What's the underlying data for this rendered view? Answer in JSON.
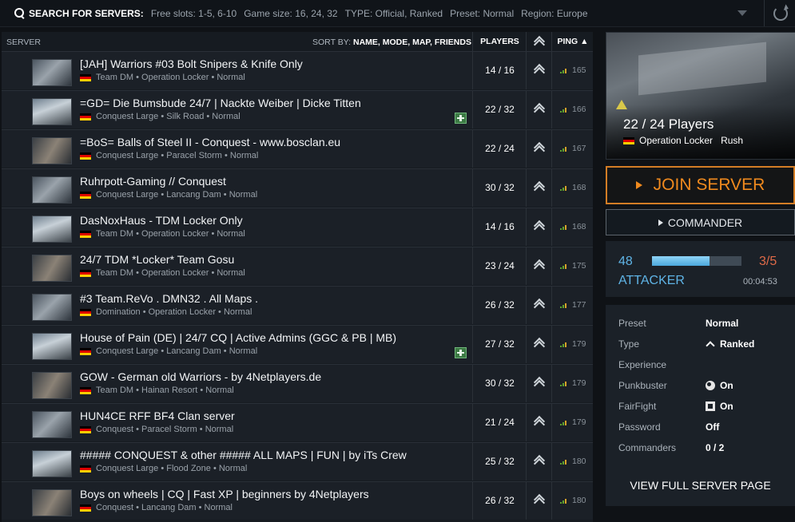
{
  "search": {
    "title": "SEARCH FOR SERVERS:",
    "filters": [
      "Free slots: 1-5, 6-10",
      "Game size: 16, 24, 32",
      "TYPE: Official, Ranked",
      "Preset: Normal",
      "Region: Europe"
    ]
  },
  "list_header": {
    "server": "SERVER",
    "sort_prefix": "SORT BY:",
    "sort_options": "NAME, MODE, MAP, FRIENDS",
    "players": "PLAYERS",
    "ping": "PING ▲"
  },
  "servers": [
    {
      "name": "[JAH] Warriors #03 Bolt Snipers & Knife Only",
      "meta": "Team DM • Operation Locker • Normal",
      "players": "14 / 16",
      "ping": "165",
      "badge": false
    },
    {
      "name": "=GD= Die Bumsbude 24/7 | Nackte Weiber | Dicke Titten",
      "meta": "Conquest Large • Silk Road • Normal",
      "players": "22 / 32",
      "ping": "166",
      "badge": true
    },
    {
      "name": "=BoS= Balls of Steel II - Conquest - www.bosclan.eu",
      "meta": "Conquest Large • Paracel Storm • Normal",
      "players": "22 / 24",
      "ping": "167",
      "badge": false
    },
    {
      "name": "Ruhrpott-Gaming // Conquest",
      "meta": "Conquest Large • Lancang Dam • Normal",
      "players": "30 / 32",
      "ping": "168",
      "badge": false
    },
    {
      "name": "DasNoxHaus - TDM Locker Only",
      "meta": "Team DM • Operation Locker • Normal",
      "players": "14 / 16",
      "ping": "168",
      "badge": false
    },
    {
      "name": "24/7 TDM *Locker* Team Gosu",
      "meta": "Team DM • Operation Locker • Normal",
      "players": "23 / 24",
      "ping": "175",
      "badge": false
    },
    {
      "name": "#3 Team.ReVo . DMN32 . All Maps .",
      "meta": "Domination • Operation Locker • Normal",
      "players": "26 / 32",
      "ping": "177",
      "badge": false
    },
    {
      "name": "House of Pain (DE) | 24/7 CQ | Active Admins (GGC & PB | MB)",
      "meta": "Conquest Large • Lancang Dam • Normal",
      "players": "27 / 32",
      "ping": "179",
      "badge": true
    },
    {
      "name": "GOW - German old Warriors - by 4Netplayers.de",
      "meta": "Team DM • Hainan Resort • Normal",
      "players": "30 / 32",
      "ping": "179",
      "badge": false
    },
    {
      "name": "HUN4CE RFF BF4 Clan server",
      "meta": "Conquest • Paracel Storm • Normal",
      "players": "21 / 24",
      "ping": "179",
      "badge": false
    },
    {
      "name": "##### CONQUEST & other ##### ALL MAPS | FUN | by iTs Crew",
      "meta": "Conquest Large • Flood Zone • Normal",
      "players": "25 / 32",
      "ping": "180",
      "badge": false
    },
    {
      "name": "Boys on wheels | CQ | Fast XP | beginners by 4Netplayers",
      "meta": "Conquest • Lancang Dam • Normal",
      "players": "26 / 32",
      "ping": "180",
      "badge": false
    }
  ],
  "selected": {
    "players": "22 / 24 Players",
    "map": "Operation Locker",
    "mode": "Rush",
    "join_label": "JOIN SERVER",
    "commander_label": "COMMANDER",
    "tickets": "48",
    "tickets_fraction": 0.64,
    "round": "3/5",
    "team": "ATTACKER",
    "time": "00:04:53",
    "details": [
      {
        "label": "Preset",
        "value": "Normal",
        "icon": ""
      },
      {
        "label": "Type",
        "value": "Ranked",
        "icon": "rank-icon"
      },
      {
        "label": "Experience",
        "value": "",
        "icon": ""
      },
      {
        "label": "Punkbuster",
        "value": "On",
        "icon": "punkbuster-icon"
      },
      {
        "label": "FairFight",
        "value": "On",
        "icon": "fairfight-icon"
      },
      {
        "label": "Password",
        "value": "Off",
        "icon": ""
      },
      {
        "label": "Commanders",
        "value": "0 / 2",
        "icon": ""
      }
    ],
    "view_full_label": "VIEW FULL SERVER PAGE"
  },
  "colors": {
    "accent": "#f08a1e",
    "team": "#5fb4e6",
    "round": "#e06a48"
  }
}
